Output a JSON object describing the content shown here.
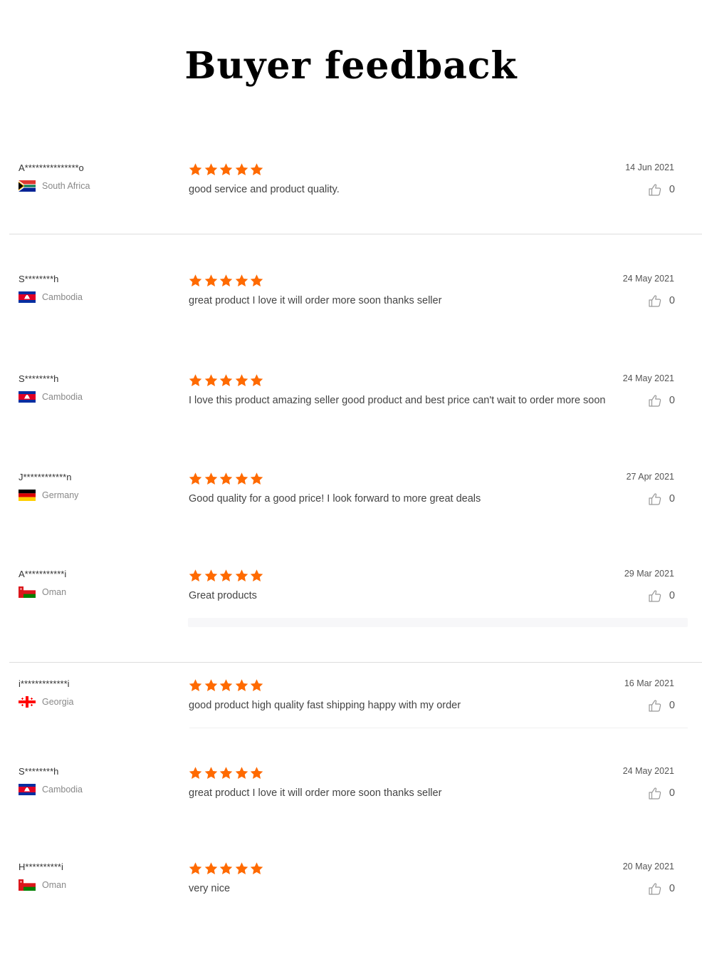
{
  "header": {
    "title": "Buyer feedback"
  },
  "colors": {
    "star": "#ff6a00",
    "divider": "#dddddd"
  },
  "reviews": [
    {
      "buyer": "A***************o",
      "country": "South Africa",
      "flag": "za",
      "rating": 5,
      "comment": "good service and product quality.",
      "date": "14 Jun 2021",
      "likes": "0"
    },
    {
      "buyer": "S********h",
      "country": "Cambodia",
      "flag": "kh",
      "rating": 5,
      "comment": "great product I love it will order more soon thanks seller",
      "date": "24 May 2021",
      "likes": "0"
    },
    {
      "buyer": "S********h",
      "country": "Cambodia",
      "flag": "kh",
      "rating": 5,
      "comment": "I love this product amazing seller good product and best price can't wait to order more soon",
      "date": "24 May 2021",
      "likes": "0"
    },
    {
      "buyer": "J************n",
      "country": "Germany",
      "flag": "de",
      "rating": 5,
      "comment": "Good quality for a good price! I look forward to more great deals",
      "date": "27 Apr 2021",
      "likes": "0"
    },
    {
      "buyer": "A***********i",
      "country": "Oman",
      "flag": "om",
      "rating": 5,
      "comment": "Great products",
      "date": "29 Mar 2021",
      "likes": "0"
    },
    {
      "buyer": "i*************i",
      "country": "Georgia",
      "flag": "ge",
      "rating": 5,
      "comment": "good product high quality fast shipping  happy with my order",
      "date": "16 Mar 2021",
      "likes": "0"
    },
    {
      "buyer": "S********h",
      "country": "Cambodia",
      "flag": "kh",
      "rating": 5,
      "comment": "great product I love it will order more soon thanks seller",
      "date": "24 May 2021",
      "likes": "0"
    },
    {
      "buyer": "H**********i",
      "country": "Oman",
      "flag": "om",
      "rating": 5,
      "comment": "very nice",
      "date": "20 May 2021",
      "likes": "0"
    }
  ]
}
